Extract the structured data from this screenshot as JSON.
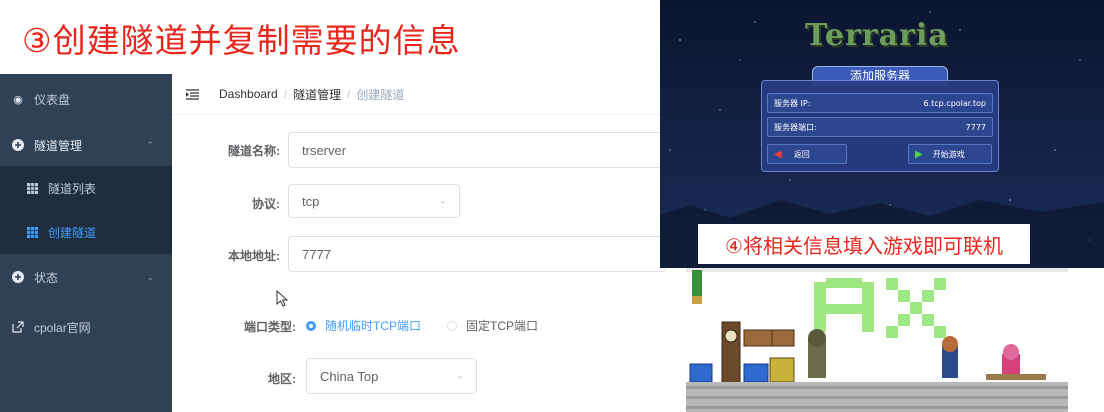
{
  "headline": "③创建隧道并复制需要的信息",
  "sidebar": {
    "items": [
      {
        "label": "仪表盘",
        "icon": "dashboard-icon"
      },
      {
        "label": "隧道管理",
        "icon": "plus-circle-icon",
        "expanded": true
      },
      {
        "label": "隧道列表",
        "icon": "grid-icon"
      },
      {
        "label": "创建隧道",
        "icon": "grid-icon",
        "active": true
      },
      {
        "label": "状态",
        "icon": "plus-circle-icon"
      },
      {
        "label": "cpolar官网",
        "icon": "external-link-icon"
      }
    ]
  },
  "breadcrumb": {
    "items": [
      "Dashboard",
      "隧道管理",
      "创建隧道"
    ]
  },
  "form": {
    "name_label": "隧道名称:",
    "name_value": "trserver",
    "protocol_label": "协议:",
    "protocol_value": "tcp",
    "local_label": "本地地址:",
    "local_value": "7777",
    "port_type_label": "端口类型:",
    "port_option_random": "随机临时TCP端口",
    "port_option_fixed": "固定TCP端口",
    "region_label": "地区:",
    "region_value": "China Top"
  },
  "game": {
    "logo": "Terraria",
    "dialog_title": "添加服务器",
    "ip_label": "服务器 IP:",
    "ip_value": "6.tcp.cpolar.top",
    "port_label": "服务器端口:",
    "port_value": "7777",
    "back_label": "返回",
    "start_label": "开始游戏"
  },
  "step4_caption": "④将相关信息填入游戏即可联机",
  "colors": {
    "headline": "#e8261c",
    "sidebar_bg": "#304156",
    "active": "#409eff",
    "game_sky": "#0f1a3a"
  }
}
